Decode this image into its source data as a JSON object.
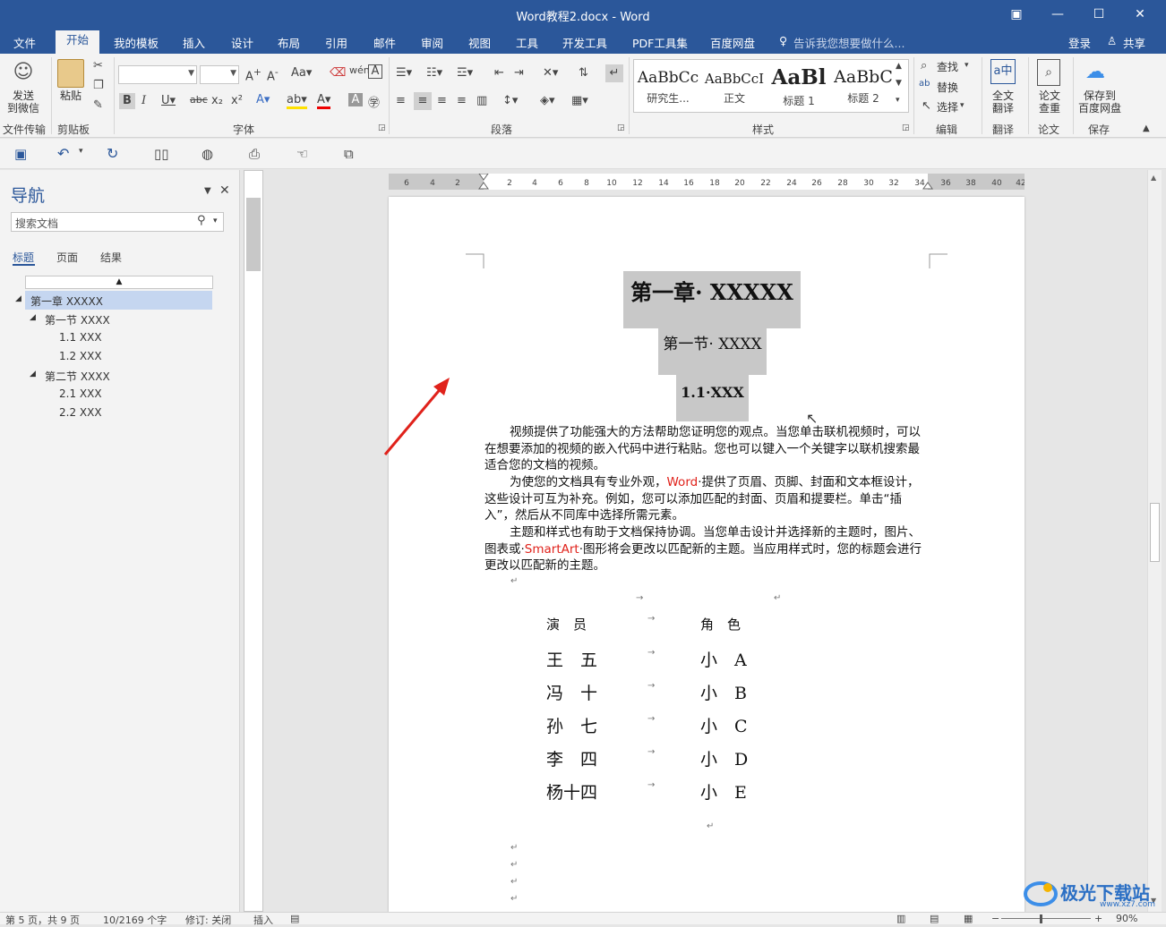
{
  "window": {
    "title": "Word教程2.docx - Word"
  },
  "tabs": [
    "文件",
    "开始",
    "我的模板",
    "插入",
    "设计",
    "布局",
    "引用",
    "邮件",
    "审阅",
    "视图",
    "工具",
    "开发工具",
    "PDF工具集",
    "百度网盘"
  ],
  "tellme": "告诉我您想要做什么...",
  "account": {
    "login": "登录",
    "share": "共享"
  },
  "ribbon": {
    "send_wechat": "发送\n到微信",
    "paste": "粘贴",
    "groups": [
      "文件传输",
      "剪贴板",
      "字体",
      "段落",
      "样式",
      "编辑",
      "翻译",
      "论文",
      "保存"
    ],
    "styles": [
      {
        "preview": "AaBbCc",
        "name": "研究生..."
      },
      {
        "preview": "AaBbCcI",
        "name": "正文"
      },
      {
        "preview": "AaBl",
        "name": "标题 1"
      },
      {
        "preview": "AaBbC",
        "name": "标题 2"
      }
    ],
    "find": "查找",
    "replace": "替换",
    "select": "选择",
    "full_translate": "全文\n翻译",
    "paper_check": "论文\n查重",
    "save_baidu": "保存到\n百度网盘"
  },
  "nav": {
    "title": "导航",
    "search_placeholder": "搜索文档",
    "tabs": [
      "标题",
      "页面",
      "结果"
    ],
    "items": [
      "第一章 XXXXX",
      "第一节 XXXX",
      "1.1 XXX",
      "1.2 XXX",
      "第二节 XXXX",
      "2.1 XXX",
      "2.2 XXX"
    ]
  },
  "ruler": {
    "h_ticks": [
      "6",
      "4",
      "2",
      "2",
      "4",
      "6",
      "8",
      "10",
      "12",
      "14",
      "16",
      "18",
      "20",
      "22",
      "24",
      "26",
      "28",
      "30",
      "32",
      "34",
      "36",
      "38",
      "40",
      "42"
    ]
  },
  "doc": {
    "h1": "第一章· XXXXX",
    "h2": "第一节· XXXX",
    "h3": "1.1·XXX",
    "para1": "视频提供了功能强大的方法帮助您证明您的观点。当您单击联机视频时，可以在想要添加的视频的嵌入代码中进行粘贴。您也可以键入一个关键字以联机搜索最适合您的文档的视频。",
    "para2_a": "为使您的文档具有专业外观，",
    "para2_word": "Word",
    "para2_b": "·提供了页眉、页脚、封面和文本框设计，这些设计可互为补充。例如，您可以添加匹配的封面、页眉和提要栏。单击“插入”，然后从不同库中选择所需元素。",
    "para3_a": "主题和样式也有助于文档保持协调。当您单击设计并选择新的主题时，图片、图表或·",
    "para3_smartart": "SmartArt",
    "para3_b": "·图形将会更改以匹配新的主题。当应用样式时，您的标题会进行更改以匹配新的主题。",
    "table": {
      "header": [
        "演　员",
        "角　色"
      ],
      "rows": [
        [
          "王　五",
          "小　A"
        ],
        [
          "冯　十",
          "小　B"
        ],
        [
          "孙　七",
          "小　C"
        ],
        [
          "李　四",
          "小　D"
        ],
        [
          "杨十四",
          "小　E"
        ]
      ]
    }
  },
  "status": {
    "page": "第 5 页，共 9 页",
    "words": "10/2169 个字",
    "track": "修订: 关闭",
    "insert": "插入",
    "zoom": "90%"
  },
  "watermark": "极光下载站",
  "watermark_url": "www.xz7.com",
  "colors": {
    "brand": "#2b579a",
    "annotation_arrow": "#e0221b",
    "heading_highlight": "#c8c8c8"
  }
}
